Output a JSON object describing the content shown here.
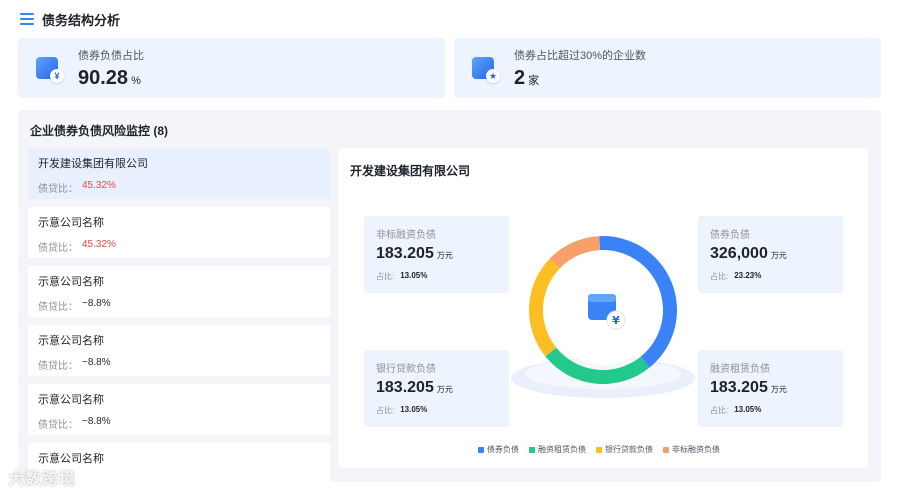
{
  "header": {
    "title": "债务结构分析"
  },
  "stats": [
    {
      "label": "债券负债占比",
      "value": "90.28",
      "unit": "%"
    },
    {
      "label": "债券占比超过30%的企业数",
      "value": "2",
      "unit": "家"
    }
  ],
  "monitor": {
    "title": "企业债券负债风险监控 (8)",
    "ratio_label": "债贷比：",
    "companies": [
      {
        "name": "开发建设集团有限公司",
        "ratio": "45.32%",
        "highlight": true
      },
      {
        "name": "示意公司名称",
        "ratio": "45.32%",
        "highlight": true
      },
      {
        "name": "示意公司名称",
        "ratio": "−8.8%",
        "highlight": false
      },
      {
        "name": "示意公司名称",
        "ratio": "−8.8%",
        "highlight": false
      },
      {
        "name": "示意公司名称",
        "ratio": "−8.8%",
        "highlight": false
      },
      {
        "name": "示意公司名称",
        "ratio": "",
        "highlight": false
      }
    ]
  },
  "detail": {
    "title": "开发建设集团有限公司",
    "share_label": "占比:",
    "metrics": [
      {
        "label": "非标融资负债",
        "value": "183.205",
        "unit": "万元",
        "share": "13.05%"
      },
      {
        "label": "债券负债",
        "value": "326,000",
        "unit": "万元",
        "share": "23.23%"
      },
      {
        "label": "银行贷款负债",
        "value": "183.205",
        "unit": "万元",
        "share": "13.05%"
      },
      {
        "label": "融资租赁负债",
        "value": "183.205",
        "unit": "万元",
        "share": "13.05%"
      }
    ]
  },
  "chart_data": {
    "type": "pie",
    "categories": [
      "债券负债",
      "融资租赁负债",
      "银行贷款负债",
      "非标融资负债"
    ],
    "values": [
      40,
      25,
      23,
      12
    ],
    "colors": [
      "#3b82f6",
      "#22c98a",
      "#fbbf24",
      "#f7a06a"
    ]
  },
  "watermark": "大数跨境"
}
